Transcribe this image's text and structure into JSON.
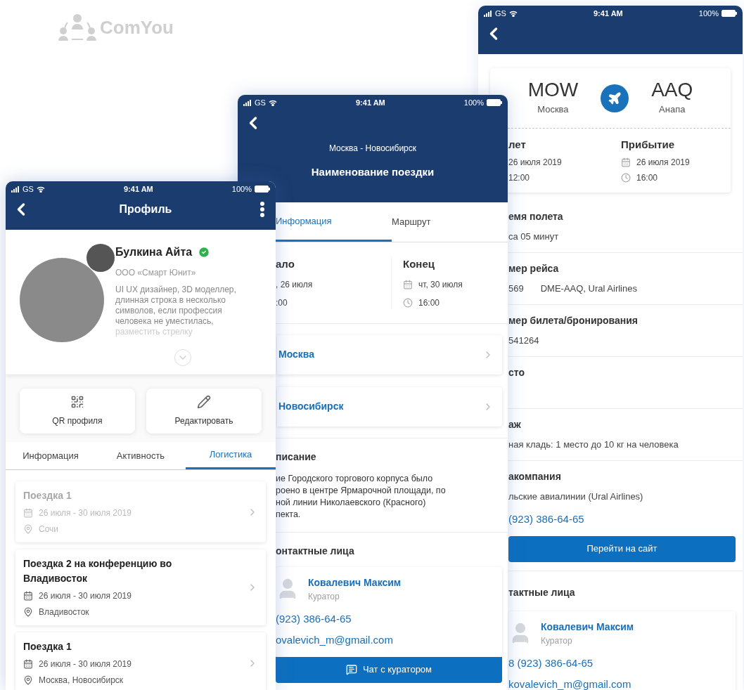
{
  "logo": {
    "text": "ComYou"
  },
  "flight_screen": {
    "status": {
      "carrier": "GS",
      "time": "9:41 AM",
      "battery": "100%"
    },
    "from": {
      "code": "MOW",
      "city": "Москва"
    },
    "to": {
      "code": "AAQ",
      "city": "Анапа"
    },
    "departure": {
      "label": "лет",
      "date": "26 июля 2019",
      "time": "12:00"
    },
    "arrival": {
      "label": "Прибытие",
      "date": "26 июля 2019",
      "time": "16:00"
    },
    "sections": [
      {
        "title": "емя полета",
        "value": "са 05 минут"
      },
      {
        "title": "мер рейса",
        "value": "569",
        "extra": "DME-AAQ, Ural Airlines"
      },
      {
        "title": "мер билета/бронирования",
        "value": "541264"
      },
      {
        "title": "сто"
      },
      {
        "title": "аж",
        "value": "ная кладь: 1 место до 10 кг на человека"
      },
      {
        "title": "акомпания",
        "value": "льские авиалинии (Ural Airlines)",
        "phone": "(923) 386-64-65",
        "button": "Перейти на сайт"
      }
    ],
    "contacts": {
      "title": "тактные лица",
      "name": "Ковалевич Максим",
      "role": "Куратор",
      "phone": "8 (923) 386-64-65",
      "email": "kovalevich_m@gmail.com"
    }
  },
  "trip_screen": {
    "status": {
      "carrier": "GS",
      "time": "9:41 AM",
      "battery": "100%"
    },
    "subtitle": "Москва - Новосибирск",
    "title": "Наименование поездки",
    "tabs": [
      {
        "label": "Информация",
        "selected": true
      },
      {
        "label": "Маршрут",
        "selected": false
      }
    ],
    "start": {
      "label": "ало",
      "date": ", 26 июля",
      "time": ":00"
    },
    "end": {
      "label": "Конец",
      "date": "чт, 30 июля",
      "time": "16:00"
    },
    "places": [
      "Москва",
      "Новосибирск"
    ],
    "description": {
      "title": "писание",
      "text": "ие Городского торгового корпуса было\nроено в центре Ярмарочной площади, по\nной линии Николаевского (Красного)\nпекта."
    },
    "contacts": {
      "title": "онтактные лица",
      "name": "Ковалевич Максим",
      "role": "Куратор",
      "phone": "(923) 386-64-65",
      "email": "ovalevich_m@gmail.com",
      "button": "Чат с куратором"
    }
  },
  "profile_screen": {
    "status": {
      "carrier": "GS",
      "time": "9:41 AM",
      "battery": "100%"
    },
    "title": "Профиль",
    "name": "Булкина Айта",
    "verified": true,
    "company": "ООО «Смарт Юнит»",
    "bio": "UI UX дизайнер, 3D моделлер, длинная строка в несколько символов, если профессия человека не уместилась,",
    "bio_faded": "разместить стрелку",
    "actions": [
      {
        "kind": "qr",
        "label": "QR профиля"
      },
      {
        "kind": "edit",
        "label": "Редактировать"
      }
    ],
    "tabs": [
      {
        "label": "Информация",
        "selected": false
      },
      {
        "label": "Активность",
        "selected": false
      },
      {
        "label": "Логистика",
        "selected": true
      }
    ],
    "trips": [
      {
        "title": "Поездка 1",
        "dates": "26 июля - 30 июля 2019",
        "place": "Сочи",
        "disabled": true
      },
      {
        "title": "Поездка 2 на конференцию во Владивосток",
        "dates": "26 июля - 30 июля 2019",
        "place": "Владивосток",
        "disabled": false
      },
      {
        "title": "Поездка 1",
        "dates": "26 июля - 30 июля 2019",
        "place": "Москва, Новосибирск",
        "disabled": false
      }
    ]
  }
}
